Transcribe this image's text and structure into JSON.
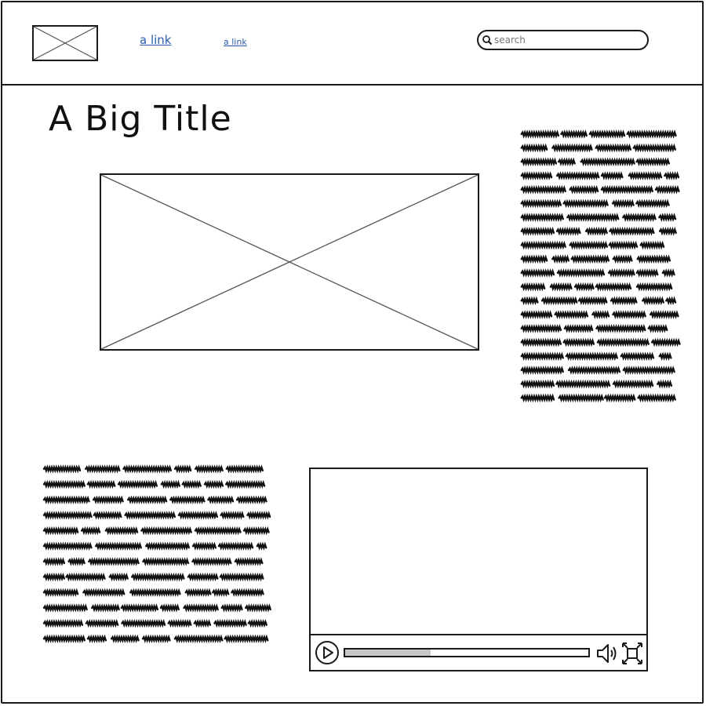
{
  "header": {
    "logo_icon": "image-placeholder-icon",
    "nav": [
      {
        "label": "a link"
      },
      {
        "label": "a link"
      }
    ],
    "search": {
      "placeholder": "search",
      "value": "",
      "icon": "search-icon"
    }
  },
  "main": {
    "title": "A Big Title",
    "hero_image_icon": "image-placeholder-icon",
    "side_text_lines": 20,
    "body_text_lines": 12
  },
  "video": {
    "play_icon": "play-icon",
    "progress": 0.35,
    "volume_icon": "volume-icon",
    "fullscreen_icon": "fullscreen-icon"
  },
  "colors": {
    "ink": "#1a1a1a",
    "link": "#2a5db0",
    "progress_fill": "#c8c8c8"
  }
}
